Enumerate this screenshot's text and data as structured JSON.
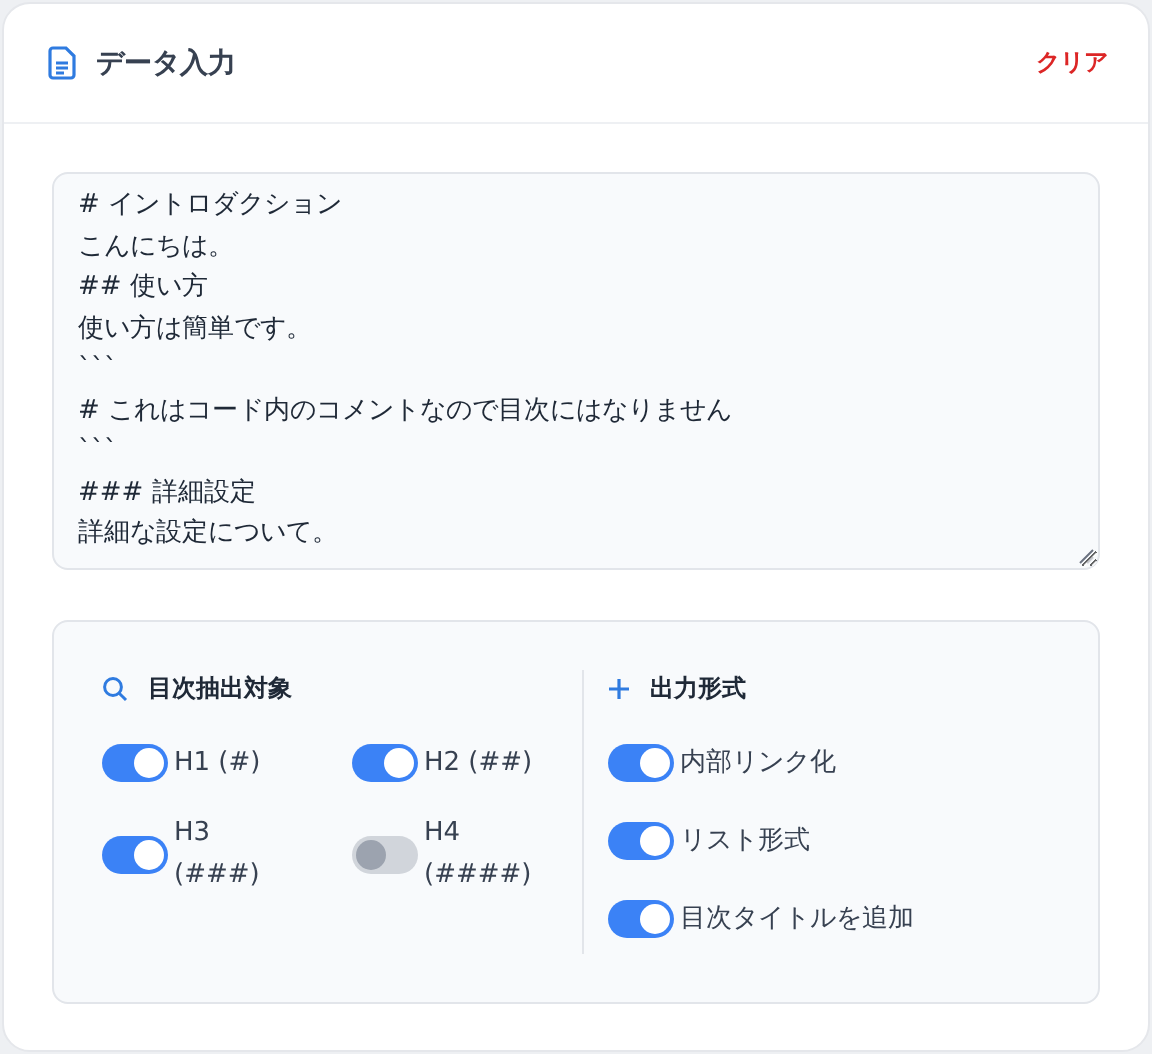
{
  "header": {
    "title": "データ入力",
    "clear_button": "クリア"
  },
  "editor": {
    "lines": [
      "# イントロダクション",
      "こんにちは。",
      "## 使い方",
      "使い方は簡単です。",
      "```",
      "# これはコード内のコメントなので目次にはなりません",
      "```",
      "### 詳細設定",
      "詳細な設定について。"
    ]
  },
  "extract_targets": {
    "title": "目次抽出対象",
    "options": [
      {
        "label": "H1 (#)",
        "on": true
      },
      {
        "label": "H2 (##)",
        "on": true
      },
      {
        "label": "H3 (###)",
        "on": true
      },
      {
        "label": "H4 (####)",
        "on": false
      }
    ]
  },
  "output_format": {
    "title": "出力形式",
    "options": [
      {
        "label": "内部リンク化",
        "on": true
      },
      {
        "label": "リスト形式",
        "on": true
      },
      {
        "label": "目次タイトルを追加",
        "on": true
      }
    ]
  }
}
